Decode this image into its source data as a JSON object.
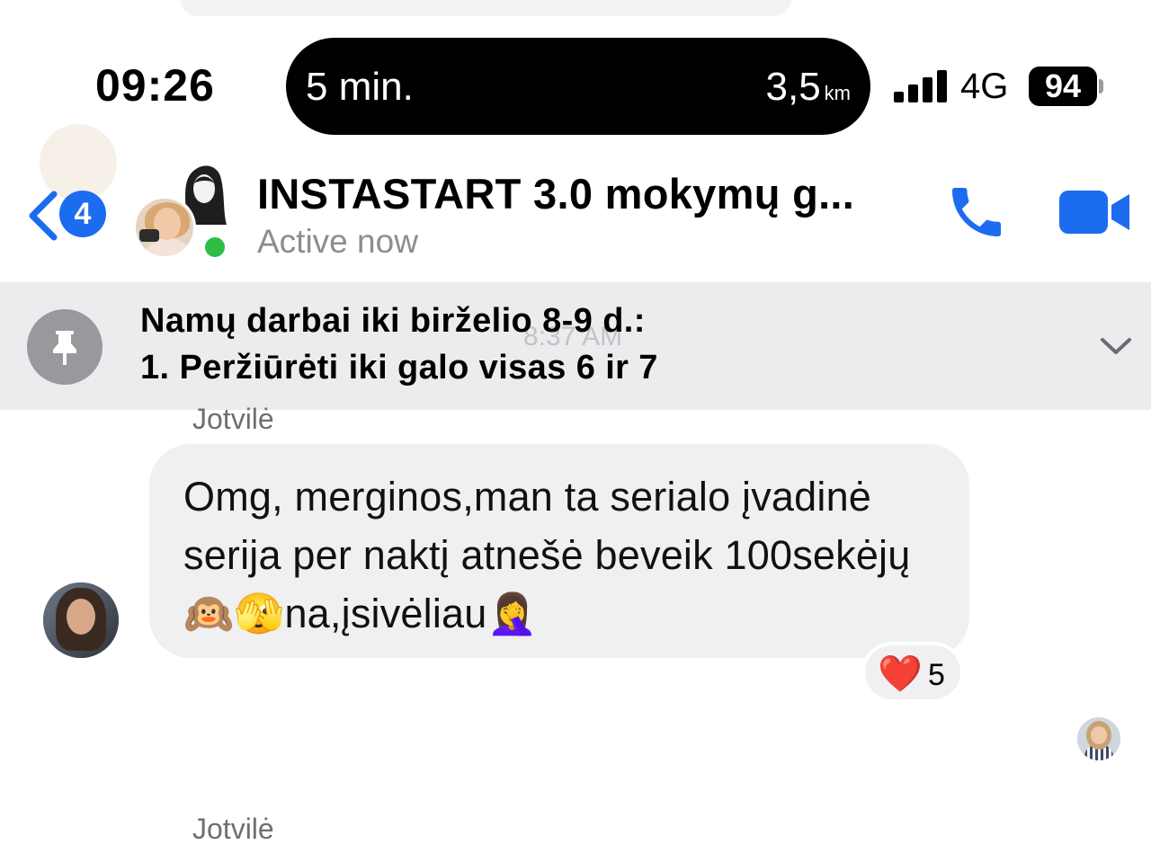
{
  "status_bar": {
    "time": "09:26",
    "island_left": "5 min.",
    "island_distance": "3,5",
    "island_unit": "km",
    "network": "4G",
    "battery": "94",
    "signal_icon": "cellular-signal-icon"
  },
  "header": {
    "back_badge_count": "4",
    "title": "INSTASTART 3.0 mokymų g...",
    "subtitle": "Active now",
    "accent_color": "#1c6cf0",
    "online_color": "#2dbe45"
  },
  "pinned": {
    "line1": "Namų darbai iki birželio 8-9 d.:",
    "line2": "1. Peržiūrėti iki galo visas 6 ir 7",
    "ghost_time": "8:37 AM"
  },
  "messages": [
    {
      "sender": "Jotvilė",
      "text": "Omg, merginos,man ta serialo įvadinė serija per naktį atnešė beveik 100sekėjų🙉🫣na,įsivėliau🤦‍♀️",
      "reaction_icon": "❤️",
      "reaction_count": "5"
    },
    {
      "sender": "Jotvilė"
    }
  ]
}
